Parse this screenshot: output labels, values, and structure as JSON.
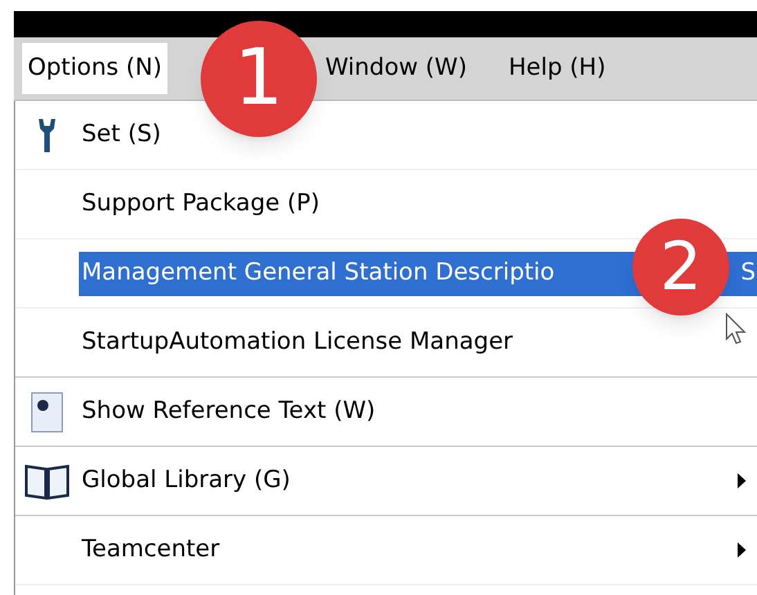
{
  "menubar": [
    {
      "label": "Options (N)",
      "selected": true
    },
    {
      "label": "Window (W)",
      "selected": false
    },
    {
      "label": "Help (H)",
      "selected": false
    }
  ],
  "menu": [
    {
      "label": "Set (S)",
      "kind": "wrench",
      "selected": false,
      "submenu": false,
      "separator_after": false
    },
    {
      "label": "Support Package (P)",
      "selected": false,
      "submenu": false,
      "separator_after": false
    },
    {
      "label": "Management General Station Descriptio",
      "trailing_text": "S",
      "selected": true,
      "submenu": false,
      "separator_after": false
    },
    {
      "label": "StartupAutomation License Manager",
      "selected": false,
      "submenu": false,
      "separator_after": true
    },
    {
      "label": "Show Reference Text (W)",
      "kind": "document",
      "selected": false,
      "submenu": false,
      "separator_after": true
    },
    {
      "label": "Global Library (G)",
      "kind": "book",
      "selected": false,
      "submenu": true,
      "separator_after": true
    },
    {
      "label": "Teamcenter",
      "selected": false,
      "submenu": true,
      "separator_after": false
    }
  ],
  "annotations": [
    {
      "label": "1"
    },
    {
      "label": "2"
    }
  ]
}
